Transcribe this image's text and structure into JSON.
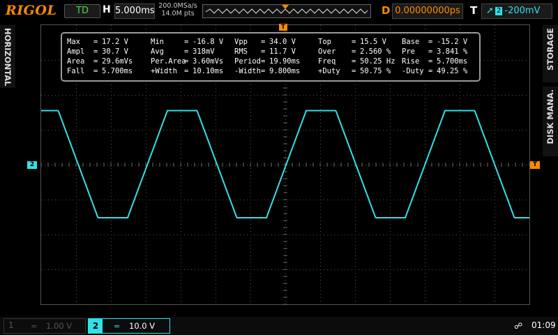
{
  "top": {
    "brand": "RIGOL",
    "run_state": "TD",
    "horizontal_letter": "H",
    "timebase": "5.000ms",
    "sample_rate": "200.0MSa/s",
    "memory_depth": "14.0M pts",
    "delay_letter": "D",
    "delay_value": "0.00000000ps",
    "trigger_letter": "T",
    "trigger_channel": "2",
    "trigger_level": "-200mV"
  },
  "side": {
    "horizontal": "HORIZONTAL",
    "storage": "STORAGE",
    "disk": "DISK MANA."
  },
  "markers": {
    "channel2": "2",
    "trigger": "T",
    "top_trigger": "T"
  },
  "measurements": {
    "rows": [
      [
        [
          "Max",
          "17.2 V"
        ],
        [
          "Min",
          "-16.8 V"
        ],
        [
          "Vpp",
          "34.0 V"
        ],
        [
          "Top",
          "15.5 V"
        ],
        [
          "Base",
          "-15.2 V"
        ]
      ],
      [
        [
          "Ampl",
          "30.7 V"
        ],
        [
          "Avg",
          "318mV"
        ],
        [
          "RMS",
          "11.7 V"
        ],
        [
          "Over",
          "2.560 %"
        ],
        [
          "Pre",
          "3.841 %"
        ]
      ],
      [
        [
          "Area",
          "29.6mVs"
        ],
        [
          "Per.Area",
          "3.60mVs"
        ],
        [
          "Period",
          "19.90ms"
        ],
        [
          "Freq",
          "50.25 Hz"
        ],
        [
          "Rise",
          "5.700ms"
        ]
      ],
      [
        [
          "Fall",
          "5.700ms"
        ],
        [
          "+Width",
          "10.10ms"
        ],
        [
          "-Width",
          "9.800ms"
        ],
        [
          "+Duty",
          "50.75 %"
        ],
        [
          "-Duty",
          "49.25 %"
        ]
      ]
    ]
  },
  "bottom": {
    "ch1_number": "1",
    "ch1_coupling": "=",
    "ch1_scale": "1.00 V",
    "ch2_number": "2",
    "ch2_coupling": "=",
    "ch2_scale": "10.0 V",
    "time": "01:09"
  },
  "colors": {
    "ch2_trace": "#31e1e6",
    "accent": "#ff8a00",
    "run_state": "#4cd94c"
  },
  "waveform": {
    "shape": "trapezoid",
    "period_ms": 19.9,
    "rise_ms": 5.7,
    "fall_ms": 5.7,
    "top_v": 15.5,
    "base_v": -15.2,
    "volts_per_div": 10.0,
    "time_per_div_ms": 5.0
  }
}
